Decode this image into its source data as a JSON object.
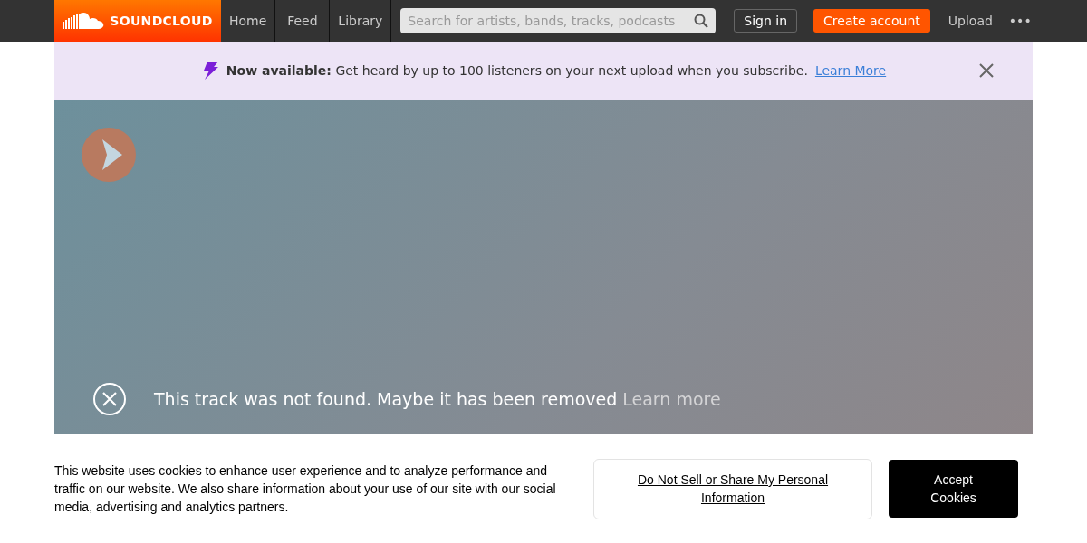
{
  "header": {
    "logo": "SOUNDCLOUD",
    "nav": [
      "Home",
      "Feed",
      "Library"
    ],
    "search": {
      "placeholder": "Search for artists, bands, tracks, podcasts"
    },
    "sign_in": "Sign in",
    "create_account": "Create account",
    "upload": "Upload",
    "more": "•••"
  },
  "banner": {
    "lead": "Now available:",
    "text": "Get heard by up to 100 listeners on your next upload when you subscribe.",
    "link": "Learn More"
  },
  "player": {
    "message": "This track was not found. Maybe it has been removed",
    "link": "Learn more"
  },
  "cookie": {
    "text": "This website uses cookies to enhance user experience and to analyze performance and traffic on our website. We also share information about your use of our site with our social media, advertising and analytics partners.",
    "do_not_sell": "Do Not Sell or Share My Personal Information",
    "accept": "Accept Cookies"
  }
}
